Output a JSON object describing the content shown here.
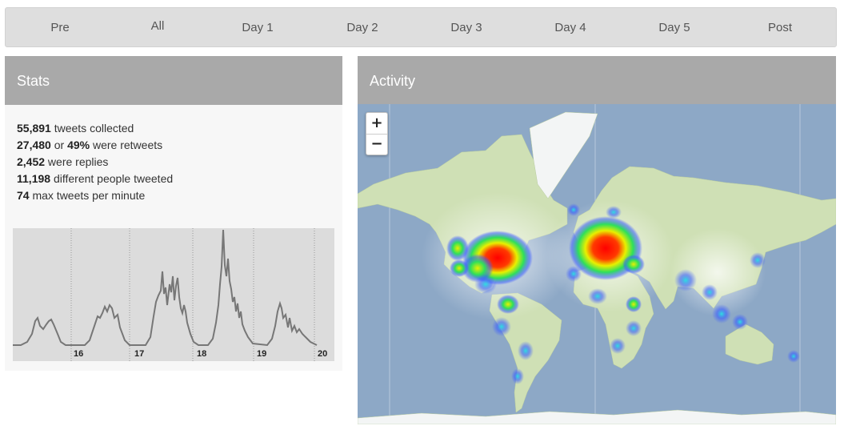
{
  "tabs": [
    {
      "label": "Pre",
      "active": false
    },
    {
      "label": "All",
      "active": true
    },
    {
      "label": "Day 1",
      "active": false
    },
    {
      "label": "Day 2",
      "active": false
    },
    {
      "label": "Day 3",
      "active": false
    },
    {
      "label": "Day 4",
      "active": false
    },
    {
      "label": "Day 5",
      "active": false
    },
    {
      "label": "Post",
      "active": false
    }
  ],
  "stats": {
    "title": "Stats",
    "lines": [
      {
        "value": "55,891",
        "text": " tweets collected"
      },
      {
        "value": "27,480",
        "text": " or ",
        "value2": "49%",
        "text2": " were retweets"
      },
      {
        "value": "2,452",
        "text": " were replies"
      },
      {
        "value": "11,198",
        "text": " different people tweeted"
      },
      {
        "value": "74",
        "text": " max tweets per minute"
      }
    ],
    "chart_labels": [
      "16",
      "17",
      "18",
      "19",
      "20"
    ]
  },
  "activity": {
    "title": "Activity",
    "zoom_in": "+",
    "zoom_out": "−"
  },
  "colors": {
    "ocean": "#8da8c6",
    "land": "#cfe0b5",
    "heat_red": "#ff0000",
    "heat_yellow": "#e8f000",
    "heat_green": "#2ee05a",
    "heat_blue": "#3a5cff"
  }
}
